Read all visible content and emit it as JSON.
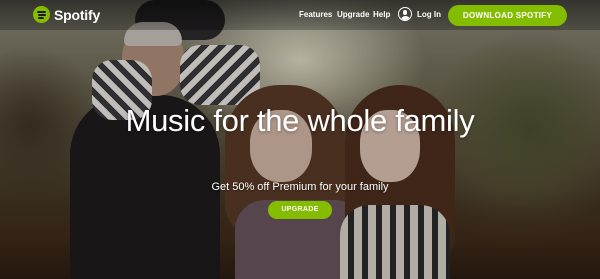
{
  "brand": {
    "name": "Spotify",
    "accent_color": "#84bd00",
    "logo_icon": "spotify-logo-icon"
  },
  "nav": {
    "links": [
      "Features",
      "Upgrade",
      "Help"
    ],
    "login_label": "Log In",
    "login_icon": "user-icon",
    "download_label": "DOWNLOAD SPOTIFY"
  },
  "hero": {
    "headline": "Music for the whole family",
    "subheadline": "Get 50% off Premium for your family",
    "cta_label": "UPGRADE",
    "image_subject": "family-photo"
  }
}
